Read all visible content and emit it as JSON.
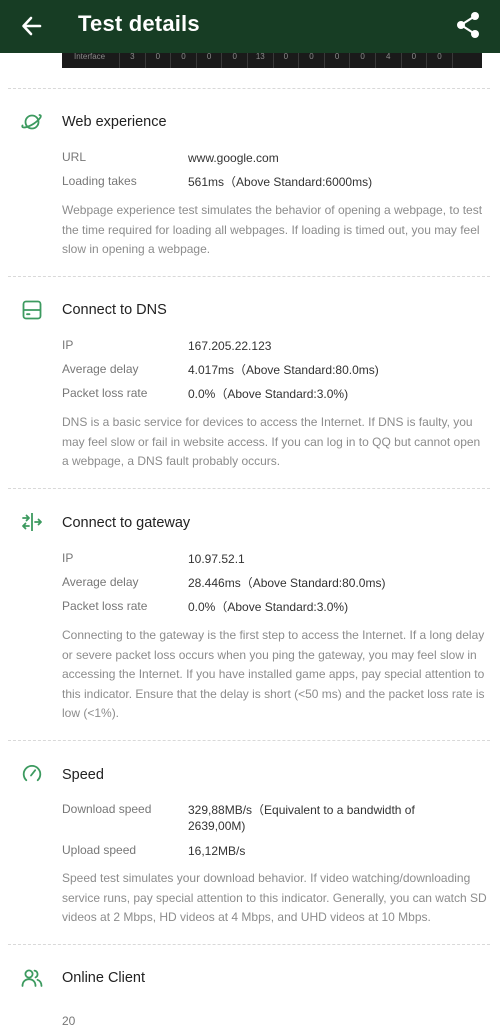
{
  "header": {
    "title": "Test details",
    "strip_label": "Interface",
    "strip_values": [
      "3",
      "0",
      "0",
      "0",
      "0",
      "13",
      "0",
      "0",
      "0",
      "0",
      "4",
      "0",
      "0"
    ]
  },
  "web": {
    "title": "Web experience",
    "url_label": "URL",
    "url_value": "www.google.com",
    "loading_label": "Loading takes",
    "loading_value": "561ms（Above Standard:6000ms)",
    "desc": "Webpage experience test simulates the behavior of opening a webpage, to test the time required for loading all webpages. If loading is timed out, you may feel slow in opening a webpage."
  },
  "dns": {
    "title": "Connect to DNS",
    "ip_label": "IP",
    "ip_value": "167.205.22.123",
    "delay_label": "Average delay",
    "delay_value": "4.017ms（Above Standard:80.0ms)",
    "loss_label": "Packet loss rate",
    "loss_value": "0.0%（Above Standard:3.0%)",
    "desc": "DNS is a basic service for devices to access the Internet. If DNS is faulty, you may feel slow or fail in website access. If you can log in to QQ but cannot open a webpage, a DNS fault probably occurs."
  },
  "gateway": {
    "title": "Connect to gateway",
    "ip_label": "IP",
    "ip_value": "10.97.52.1",
    "delay_label": "Average delay",
    "delay_value": "28.446ms（Above Standard:80.0ms)",
    "loss_label": "Packet loss rate",
    "loss_value": "0.0%（Above Standard:3.0%)",
    "desc": "Connecting to the gateway is the first step to access the Internet. If a long delay or severe packet loss occurs when you ping the gateway, you may feel slow in accessing the Internet. If you have installed game apps, pay special attention to this indicator. Ensure that the delay is short (<50 ms) and the packet loss rate is low (<1%)."
  },
  "speed": {
    "title": "Speed",
    "download_label": "Download speed",
    "download_value": "329,88MB/s（Equivalent to a bandwidth of 2639,00M)",
    "upload_label": "Upload speed",
    "upload_value": "16,12MB/s",
    "desc": "Speed test simulates your download behavior. If video watching/downloading service runs, pay special attention to this indicator. Generally, you can watch SD videos at 2 Mbps, HD videos at 4 Mbps, and UHD videos at 10 Mbps."
  },
  "client": {
    "title": "Online Client",
    "partial_value": "20"
  },
  "colors": {
    "appbar": "#173d24",
    "accent": "#3c9a5f"
  },
  "icons": {
    "back": "arrow-left-icon",
    "share": "share-icon",
    "web": "planet-icon",
    "dns": "server-icon",
    "gateway": "gateway-arrows-icon",
    "speed": "gauge-icon",
    "client": "users-icon"
  }
}
